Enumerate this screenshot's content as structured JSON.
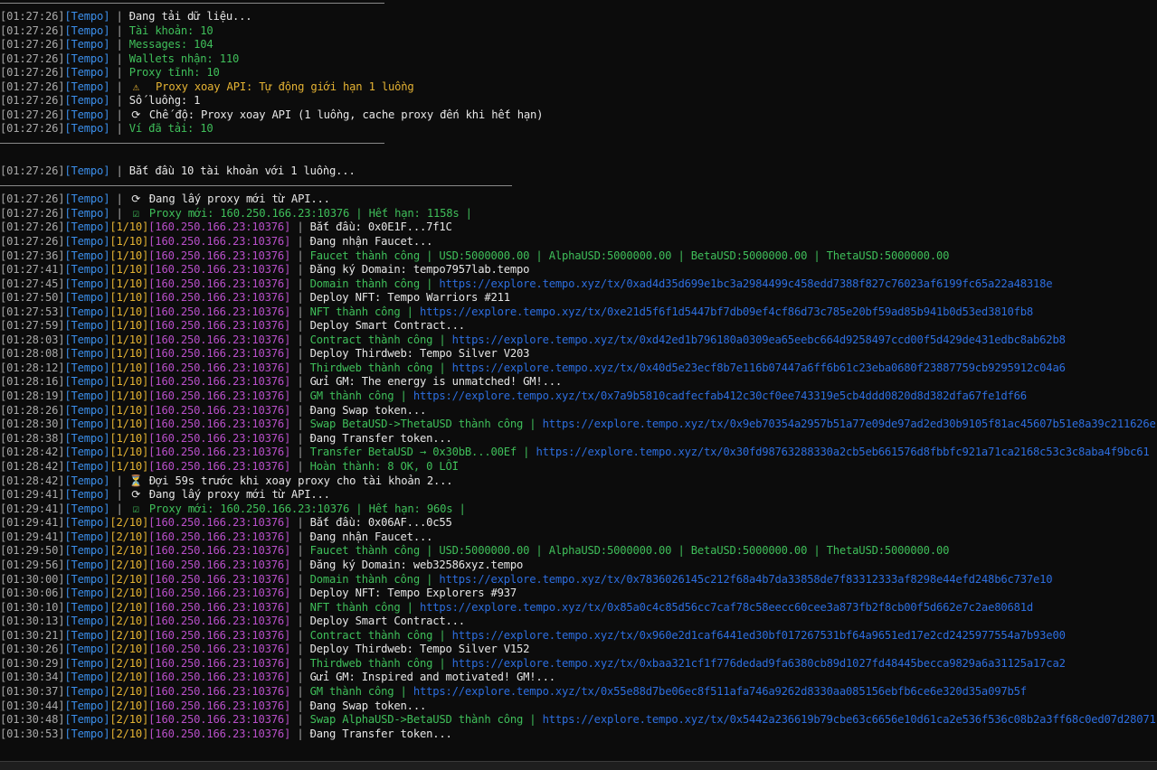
{
  "app": {
    "tag": "[Tempo]",
    "separator": "|"
  },
  "colors": {
    "background": "#0c0c0c",
    "timestamp": "#a8a8a8",
    "tag": "#3b8eea",
    "counter": "#e5b333",
    "proxy": "#b84fc9",
    "info": "#e6e6e6",
    "success": "#3fbf5a",
    "warning": "#e5b333",
    "link": "#2d6ee0"
  },
  "lines": [
    {
      "ts": "[01:27:26]",
      "tag": "[Tempo]",
      "msg": [
        {
          "c": "white",
          "t": "Đang tải dữ liệu..."
        }
      ]
    },
    {
      "ts": "[01:27:26]",
      "tag": "[Tempo]",
      "msg": [
        {
          "c": "green",
          "t": "Tài khoản: 10"
        }
      ]
    },
    {
      "ts": "[01:27:26]",
      "tag": "[Tempo]",
      "msg": [
        {
          "c": "green",
          "t": "Messages: 104"
        }
      ]
    },
    {
      "ts": "[01:27:26]",
      "tag": "[Tempo]",
      "msg": [
        {
          "c": "green",
          "t": "Wallets nhận: 110"
        }
      ]
    },
    {
      "ts": "[01:27:26]",
      "tag": "[Tempo]",
      "msg": [
        {
          "c": "green",
          "t": "Proxy tĩnh: 10"
        }
      ]
    },
    {
      "ts": "[01:27:26]",
      "tag": "[Tempo]",
      "icon": "warning-icon",
      "msg": [
        {
          "c": "yellow",
          "t": " Proxy xoay API: Tự động giới hạn 1 luồng"
        }
      ]
    },
    {
      "ts": "[01:27:26]",
      "tag": "[Tempo]",
      "msg": [
        {
          "c": "white",
          "t": "Số luồng: 1"
        }
      ]
    },
    {
      "ts": "[01:27:26]",
      "tag": "[Tempo]",
      "icon": "cycle-icon",
      "msg": [
        {
          "c": "white",
          "t": "Chế độ: Proxy xoay API (1 luồng, cache proxy đến khi hết hạn)"
        }
      ]
    },
    {
      "ts": "[01:27:26]",
      "tag": "[Tempo]",
      "msg": [
        {
          "c": "green",
          "t": "Ví đã tải: 10"
        }
      ]
    },
    {
      "ts": "[01:27:26]",
      "tag": "[Tempo]",
      "msg": [
        {
          "c": "white",
          "t": "Bắt đầu 10 tài khoản với 1 luồng..."
        }
      ]
    },
    {
      "ts": "[01:27:26]",
      "tag": "[Tempo]",
      "icon": "cycle-icon",
      "msg": [
        {
          "c": "white",
          "t": "Đang lấy proxy mới từ API..."
        }
      ]
    },
    {
      "ts": "[01:27:26]",
      "tag": "[Tempo]",
      "icon": "check-icon",
      "msg": [
        {
          "c": "green",
          "t": "Proxy mới: 160.250.166.23:10376 | Hết hạn: 1158s |"
        }
      ]
    },
    {
      "ts": "[01:27:26]",
      "tag": "[Tempo]",
      "acc": "[1/10]",
      "proxy": "[160.250.166.23:10376]",
      "msg": [
        {
          "c": "white",
          "t": "Bắt đầu: 0x0E1F...7f1C"
        }
      ]
    },
    {
      "ts": "[01:27:26]",
      "tag": "[Tempo]",
      "acc": "[1/10]",
      "proxy": "[160.250.166.23:10376]",
      "msg": [
        {
          "c": "white",
          "t": "Đang nhận Faucet..."
        }
      ]
    },
    {
      "ts": "[01:27:36]",
      "tag": "[Tempo]",
      "acc": "[1/10]",
      "proxy": "[160.250.166.23:10376]",
      "msg": [
        {
          "c": "green",
          "t": "Faucet thành công | USD:5000000.00 | AlphaUSD:5000000.00 | BetaUSD:5000000.00 | ThetaUSD:5000000.00"
        }
      ]
    },
    {
      "ts": "[01:27:41]",
      "tag": "[Tempo]",
      "acc": "[1/10]",
      "proxy": "[160.250.166.23:10376]",
      "msg": [
        {
          "c": "white",
          "t": "Đăng ký Domain: tempo7957lab.tempo"
        }
      ]
    },
    {
      "ts": "[01:27:45]",
      "tag": "[Tempo]",
      "acc": "[1/10]",
      "proxy": "[160.250.166.23:10376]",
      "msg": [
        {
          "c": "green",
          "t": "Domain thành công | "
        },
        {
          "c": "link",
          "t": "https://explore.tempo.xyz/tx/0xad4d35d699e1bc3a2984499c458edd7388f827c76023af6199fc65a22a48318e"
        }
      ]
    },
    {
      "ts": "[01:27:50]",
      "tag": "[Tempo]",
      "acc": "[1/10]",
      "proxy": "[160.250.166.23:10376]",
      "msg": [
        {
          "c": "white",
          "t": "Deploy NFT: Tempo Warriors #211"
        }
      ]
    },
    {
      "ts": "[01:27:53]",
      "tag": "[Tempo]",
      "acc": "[1/10]",
      "proxy": "[160.250.166.23:10376]",
      "msg": [
        {
          "c": "green",
          "t": "NFT thành công | "
        },
        {
          "c": "link",
          "t": "https://explore.tempo.xyz/tx/0xe21d5f6f1d5447bf7db09ef4cf86d73c785e20bf59ad85b941b0d53ed3810fb8"
        }
      ]
    },
    {
      "ts": "[01:27:59]",
      "tag": "[Tempo]",
      "acc": "[1/10]",
      "proxy": "[160.250.166.23:10376]",
      "msg": [
        {
          "c": "white",
          "t": "Deploy Smart Contract..."
        }
      ]
    },
    {
      "ts": "[01:28:03]",
      "tag": "[Tempo]",
      "acc": "[1/10]",
      "proxy": "[160.250.166.23:10376]",
      "msg": [
        {
          "c": "green",
          "t": "Contract thành công | "
        },
        {
          "c": "link",
          "t": "https://explore.tempo.xyz/tx/0xd42ed1b796180a0309ea65eebc664d9258497ccd00f5d429de431edbc8ab62b8"
        }
      ]
    },
    {
      "ts": "[01:28:08]",
      "tag": "[Tempo]",
      "acc": "[1/10]",
      "proxy": "[160.250.166.23:10376]",
      "msg": [
        {
          "c": "white",
          "t": "Deploy Thirdweb: Tempo Silver V203"
        }
      ]
    },
    {
      "ts": "[01:28:12]",
      "tag": "[Tempo]",
      "acc": "[1/10]",
      "proxy": "[160.250.166.23:10376]",
      "msg": [
        {
          "c": "green",
          "t": "Thirdweb thành công | "
        },
        {
          "c": "link",
          "t": "https://explore.tempo.xyz/tx/0x40d5e23ecf8b7e116b07447a6ff6b61c23eba0680f23887759cb9295912c04a6"
        }
      ]
    },
    {
      "ts": "[01:28:16]",
      "tag": "[Tempo]",
      "acc": "[1/10]",
      "proxy": "[160.250.166.23:10376]",
      "msg": [
        {
          "c": "white",
          "t": "Gửi GM: The energy is unmatched! GM!..."
        }
      ]
    },
    {
      "ts": "[01:28:19]",
      "tag": "[Tempo]",
      "acc": "[1/10]",
      "proxy": "[160.250.166.23:10376]",
      "msg": [
        {
          "c": "green",
          "t": "GM thành công | "
        },
        {
          "c": "link",
          "t": "https://explore.tempo.xyz/tx/0x7a9b5810cadfecfab412c30cf0ee743319e5cb4ddd0820d8d382dfa67fe1df66"
        }
      ]
    },
    {
      "ts": "[01:28:26]",
      "tag": "[Tempo]",
      "acc": "[1/10]",
      "proxy": "[160.250.166.23:10376]",
      "msg": [
        {
          "c": "white",
          "t": "Đang Swap token..."
        }
      ]
    },
    {
      "ts": "[01:28:30]",
      "tag": "[Tempo]",
      "acc": "[1/10]",
      "proxy": "[160.250.166.23:10376]",
      "msg": [
        {
          "c": "green",
          "t": "Swap BetaUSD->ThetaUSD thành công | "
        },
        {
          "c": "link",
          "t": "https://explore.tempo.xyz/tx/0x9eb70354a2957b51a77e09de97ad2ed30b9105f81ac45607b51e8a39c211626e"
        }
      ]
    },
    {
      "ts": "[01:28:38]",
      "tag": "[Tempo]",
      "acc": "[1/10]",
      "proxy": "[160.250.166.23:10376]",
      "msg": [
        {
          "c": "white",
          "t": "Đang Transfer token..."
        }
      ]
    },
    {
      "ts": "[01:28:42]",
      "tag": "[Tempo]",
      "acc": "[1/10]",
      "proxy": "[160.250.166.23:10376]",
      "msg": [
        {
          "c": "green",
          "t": "Transfer BetaUSD → 0x30bB...00Ef | "
        },
        {
          "c": "link",
          "t": "https://explore.tempo.xyz/tx/0x30fd98763288330a2cb5eb661576d8fbbfc921a71ca2168c53c3c8aba4f9bc61"
        }
      ]
    },
    {
      "ts": "[01:28:42]",
      "tag": "[Tempo]",
      "acc": "[1/10]",
      "proxy": "[160.250.166.23:10376]",
      "msg": [
        {
          "c": "green",
          "t": "Hoàn thành: 8 OK, 0 LỖI"
        }
      ]
    },
    {
      "ts": "[01:28:42]",
      "tag": "[Tempo]",
      "icon": "hourglass-icon",
      "msg": [
        {
          "c": "white",
          "t": "Đợi 59s trước khi xoay proxy cho tài khoản 2..."
        }
      ]
    },
    {
      "ts": "[01:29:41]",
      "tag": "[Tempo]",
      "icon": "cycle-icon",
      "msg": [
        {
          "c": "white",
          "t": "Đang lấy proxy mới từ API..."
        }
      ]
    },
    {
      "ts": "[01:29:41]",
      "tag": "[Tempo]",
      "icon": "check-icon",
      "msg": [
        {
          "c": "green",
          "t": "Proxy mới: 160.250.166.23:10376 | Hết hạn: 960s |"
        }
      ]
    },
    {
      "ts": "[01:29:41]",
      "tag": "[Tempo]",
      "acc": "[2/10]",
      "proxy": "[160.250.166.23:10376]",
      "msg": [
        {
          "c": "white",
          "t": "Bắt đầu: 0x06AF...0c55"
        }
      ]
    },
    {
      "ts": "[01:29:41]",
      "tag": "[Tempo]",
      "acc": "[2/10]",
      "proxy": "[160.250.166.23:10376]",
      "msg": [
        {
          "c": "white",
          "t": "Đang nhận Faucet..."
        }
      ]
    },
    {
      "ts": "[01:29:50]",
      "tag": "[Tempo]",
      "acc": "[2/10]",
      "proxy": "[160.250.166.23:10376]",
      "msg": [
        {
          "c": "green",
          "t": "Faucet thành công | USD:5000000.00 | AlphaUSD:5000000.00 | BetaUSD:5000000.00 | ThetaUSD:5000000.00"
        }
      ]
    },
    {
      "ts": "[01:29:56]",
      "tag": "[Tempo]",
      "acc": "[2/10]",
      "proxy": "[160.250.166.23:10376]",
      "msg": [
        {
          "c": "white",
          "t": "Đăng ký Domain: web32586xyz.tempo"
        }
      ]
    },
    {
      "ts": "[01:30:00]",
      "tag": "[Tempo]",
      "acc": "[2/10]",
      "proxy": "[160.250.166.23:10376]",
      "msg": [
        {
          "c": "green",
          "t": "Domain thành công | "
        },
        {
          "c": "link",
          "t": "https://explore.tempo.xyz/tx/0x7836026145c212f68a4b7da33858de7f83312333af8298e44efd248b6c737e10"
        }
      ]
    },
    {
      "ts": "[01:30:06]",
      "tag": "[Tempo]",
      "acc": "[2/10]",
      "proxy": "[160.250.166.23:10376]",
      "msg": [
        {
          "c": "white",
          "t": "Deploy NFT: Tempo Explorers #937"
        }
      ]
    },
    {
      "ts": "[01:30:10]",
      "tag": "[Tempo]",
      "acc": "[2/10]",
      "proxy": "[160.250.166.23:10376]",
      "msg": [
        {
          "c": "green",
          "t": "NFT thành công | "
        },
        {
          "c": "link",
          "t": "https://explore.tempo.xyz/tx/0x85a0c4c85d56cc7caf78c58eecc60cee3a873fb2f8cb00f5d662e7c2ae80681d"
        }
      ]
    },
    {
      "ts": "[01:30:13]",
      "tag": "[Tempo]",
      "acc": "[2/10]",
      "proxy": "[160.250.166.23:10376]",
      "msg": [
        {
          "c": "white",
          "t": "Deploy Smart Contract..."
        }
      ]
    },
    {
      "ts": "[01:30:21]",
      "tag": "[Tempo]",
      "acc": "[2/10]",
      "proxy": "[160.250.166.23:10376]",
      "msg": [
        {
          "c": "green",
          "t": "Contract thành công | "
        },
        {
          "c": "link",
          "t": "https://explore.tempo.xyz/tx/0x960e2d1caf6441ed30bf017267531bf64a9651ed17e2cd2425977554a7b93e00"
        }
      ]
    },
    {
      "ts": "[01:30:26]",
      "tag": "[Tempo]",
      "acc": "[2/10]",
      "proxy": "[160.250.166.23:10376]",
      "msg": [
        {
          "c": "white",
          "t": "Deploy Thirdweb: Tempo Silver V152"
        }
      ]
    },
    {
      "ts": "[01:30:29]",
      "tag": "[Tempo]",
      "acc": "[2/10]",
      "proxy": "[160.250.166.23:10376]",
      "msg": [
        {
          "c": "green",
          "t": "Thirdweb thành công | "
        },
        {
          "c": "link",
          "t": "https://explore.tempo.xyz/tx/0xbaa321cf1f776dedad9fa6380cb89d1027fd48445becca9829a6a31125a17ca2"
        }
      ]
    },
    {
      "ts": "[01:30:34]",
      "tag": "[Tempo]",
      "acc": "[2/10]",
      "proxy": "[160.250.166.23:10376]",
      "msg": [
        {
          "c": "white",
          "t": "Gửi GM: Inspired and motivated! GM!..."
        }
      ]
    },
    {
      "ts": "[01:30:37]",
      "tag": "[Tempo]",
      "acc": "[2/10]",
      "proxy": "[160.250.166.23:10376]",
      "msg": [
        {
          "c": "green",
          "t": "GM thành công | "
        },
        {
          "c": "link",
          "t": "https://explore.tempo.xyz/tx/0x55e88d7be06ec8f511afa746a9262d8330aa085156ebfb6ce6e320d35a097b5f"
        }
      ]
    },
    {
      "ts": "[01:30:44]",
      "tag": "[Tempo]",
      "acc": "[2/10]",
      "proxy": "[160.250.166.23:10376]",
      "msg": [
        {
          "c": "white",
          "t": "Đang Swap token..."
        }
      ]
    },
    {
      "ts": "[01:30:48]",
      "tag": "[Tempo]",
      "acc": "[2/10]",
      "proxy": "[160.250.166.23:10376]",
      "msg": [
        {
          "c": "green",
          "t": "Swap AlphaUSD->BetaUSD thành công | "
        },
        {
          "c": "link",
          "t": "https://explore.tempo.xyz/tx/0x5442a236619b79cbe63c6656e10d61ca2e536f536c08b2a3ff68c0ed07d28071"
        }
      ]
    },
    {
      "ts": "[01:30:53]",
      "tag": "[Tempo]",
      "acc": "[2/10]",
      "proxy": "[160.250.166.23:10376]",
      "msg": [
        {
          "c": "white",
          "t": "Đang Transfer token..."
        }
      ]
    }
  ]
}
